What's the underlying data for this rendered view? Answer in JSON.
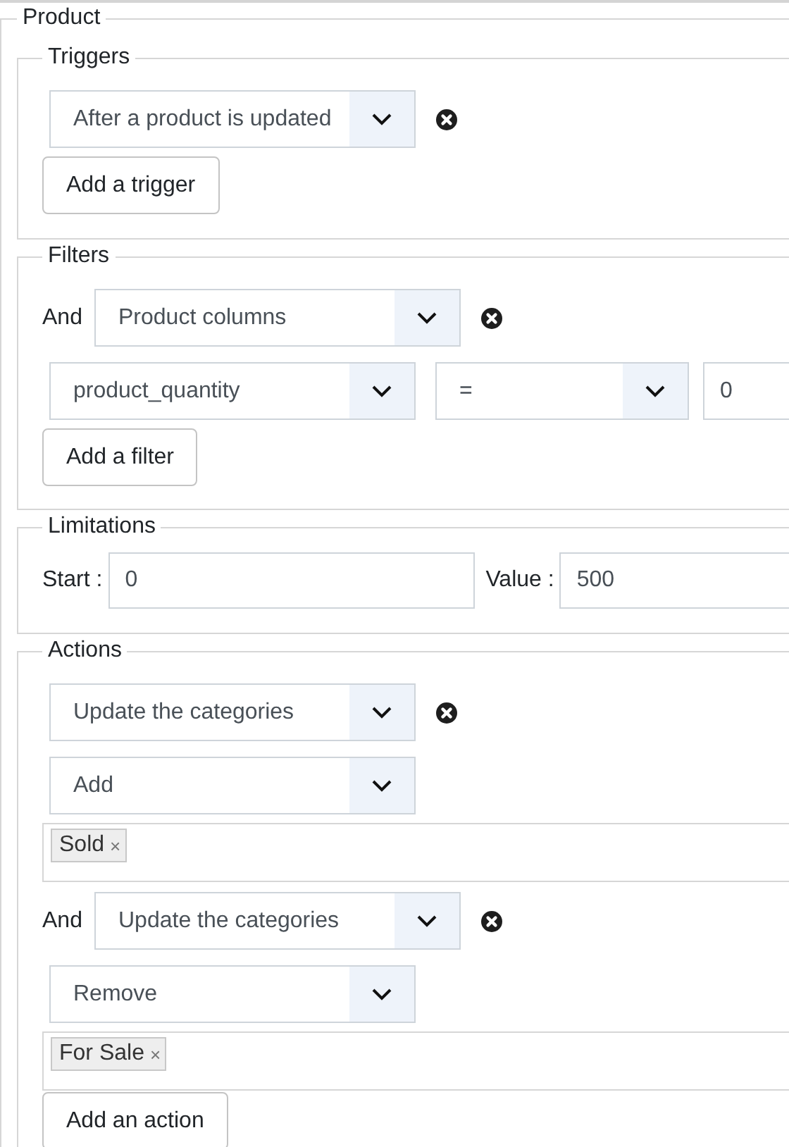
{
  "product": {
    "legend": "Product"
  },
  "triggers": {
    "legend": "Triggers",
    "items": [
      {
        "event": "After a product is updated"
      }
    ],
    "add_button": "Add a trigger"
  },
  "filters": {
    "legend": "Filters",
    "items": [
      {
        "conjunction": "And",
        "type": "Product columns",
        "column": "product_quantity",
        "operator": "=",
        "value": "0"
      }
    ],
    "add_button": "Add a filter"
  },
  "limitations": {
    "legend": "Limitations",
    "start_label": "Start :",
    "start": "0",
    "value_label": "Value :",
    "value": "500"
  },
  "actions": {
    "legend": "Actions",
    "items": [
      {
        "type": "Update the categories",
        "mode": "Add",
        "categories": [
          {
            "label": "Sold",
            "remove": "×"
          }
        ]
      },
      {
        "conjunction": "And",
        "type": "Update the categories",
        "mode": "Remove",
        "categories": [
          {
            "label": "For Sale",
            "remove": "×"
          }
        ]
      }
    ],
    "add_button": "Add an action"
  }
}
